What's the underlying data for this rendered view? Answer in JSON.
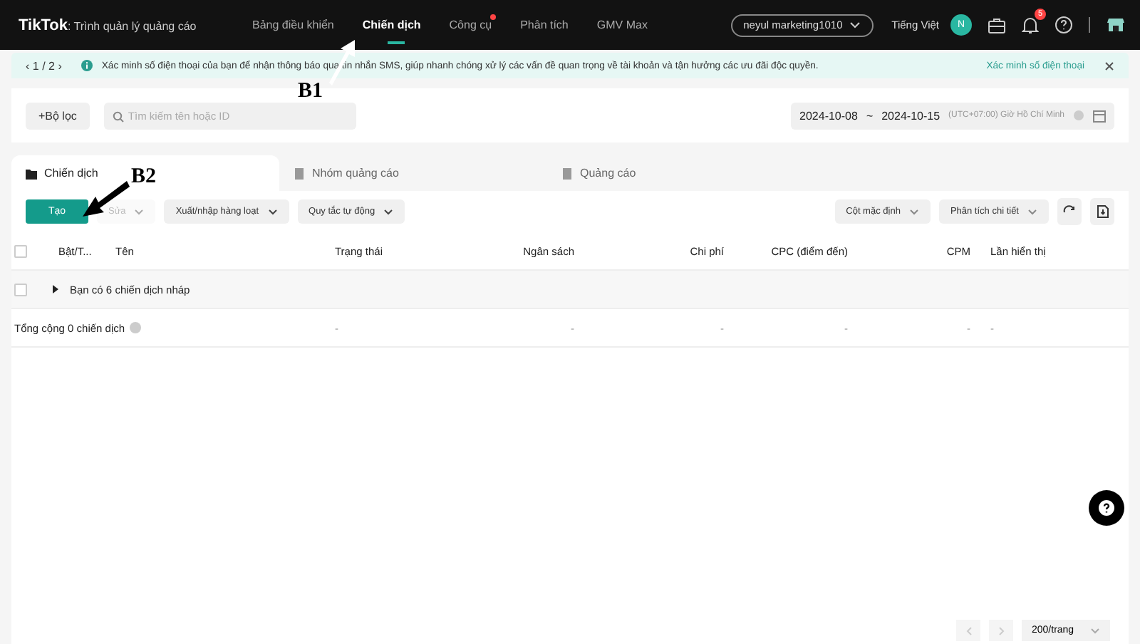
{
  "header": {
    "logo": "TikTok",
    "logo_suffix": ": Trình quản lý quảng cáo",
    "nav": [
      {
        "label": "Bảng điều khiển",
        "selected": false,
        "dot": false
      },
      {
        "label": "Chiến dịch",
        "selected": true,
        "dot": false
      },
      {
        "label": "Công cụ",
        "selected": false,
        "dot": true
      },
      {
        "label": "Phân tích",
        "selected": false,
        "dot": false
      },
      {
        "label": "GMV Max",
        "selected": false,
        "dot": false
      }
    ],
    "account": "neyul marketing1010",
    "language": "Tiếng Việt",
    "avatar": "N",
    "notifications": "5"
  },
  "banner": {
    "prev": "‹",
    "pager": "1 / 2",
    "next": "›",
    "message": "Xác minh số điện thoại của bạn để nhận thông báo qua tin nhắn SMS, giúp nhanh chóng xử lý các vấn đề quan trọng về tài khoản và tận hưởng các ưu đãi độc quyền.",
    "link": "Xác minh số điện thoại"
  },
  "filter": {
    "button": "+Bộ lọc",
    "search": {
      "placeholder": "Tìm kiếm tên hoặc ID"
    },
    "date_start": "2024-10-08",
    "date_sep": "~",
    "date_end": "2024-10-15",
    "timezone": "(UTC+07:00) Giờ Hồ Chí Minh"
  },
  "tabs": [
    {
      "label": "Chiến dịch",
      "selected": true
    },
    {
      "label": "Nhóm quảng cáo",
      "selected": false
    },
    {
      "label": "Quảng cáo",
      "selected": false
    }
  ],
  "toolbar": {
    "create": "Tạo",
    "edit": {
      "label": "Sửa",
      "disabled": true
    },
    "menus": [
      "Xuất/nhập hàng loạt",
      "Quy tắc tự động"
    ],
    "right_menus": [
      "Cột mặc định",
      "Phân tích chi tiết"
    ]
  },
  "table": {
    "select_all_checked": false,
    "draft_checked": false,
    "columns": [
      "Bật/T...",
      "Tên",
      "Trạng thái",
      "Ngân sách",
      "Chi phí",
      "CPC (điểm đến)",
      "CPM",
      "Lần hiển thị"
    ],
    "draft_row": "Bạn có 6 chiến dịch nháp",
    "total_row": {
      "label": "Tổng cộng 0 chiến dịch",
      "values": [
        "-",
        "-",
        "-",
        "-",
        "-",
        "-"
      ]
    }
  },
  "pagination": {
    "page_size": "200/trang"
  },
  "annotations": [
    {
      "label": "B1"
    },
    {
      "label": "B2"
    }
  ]
}
